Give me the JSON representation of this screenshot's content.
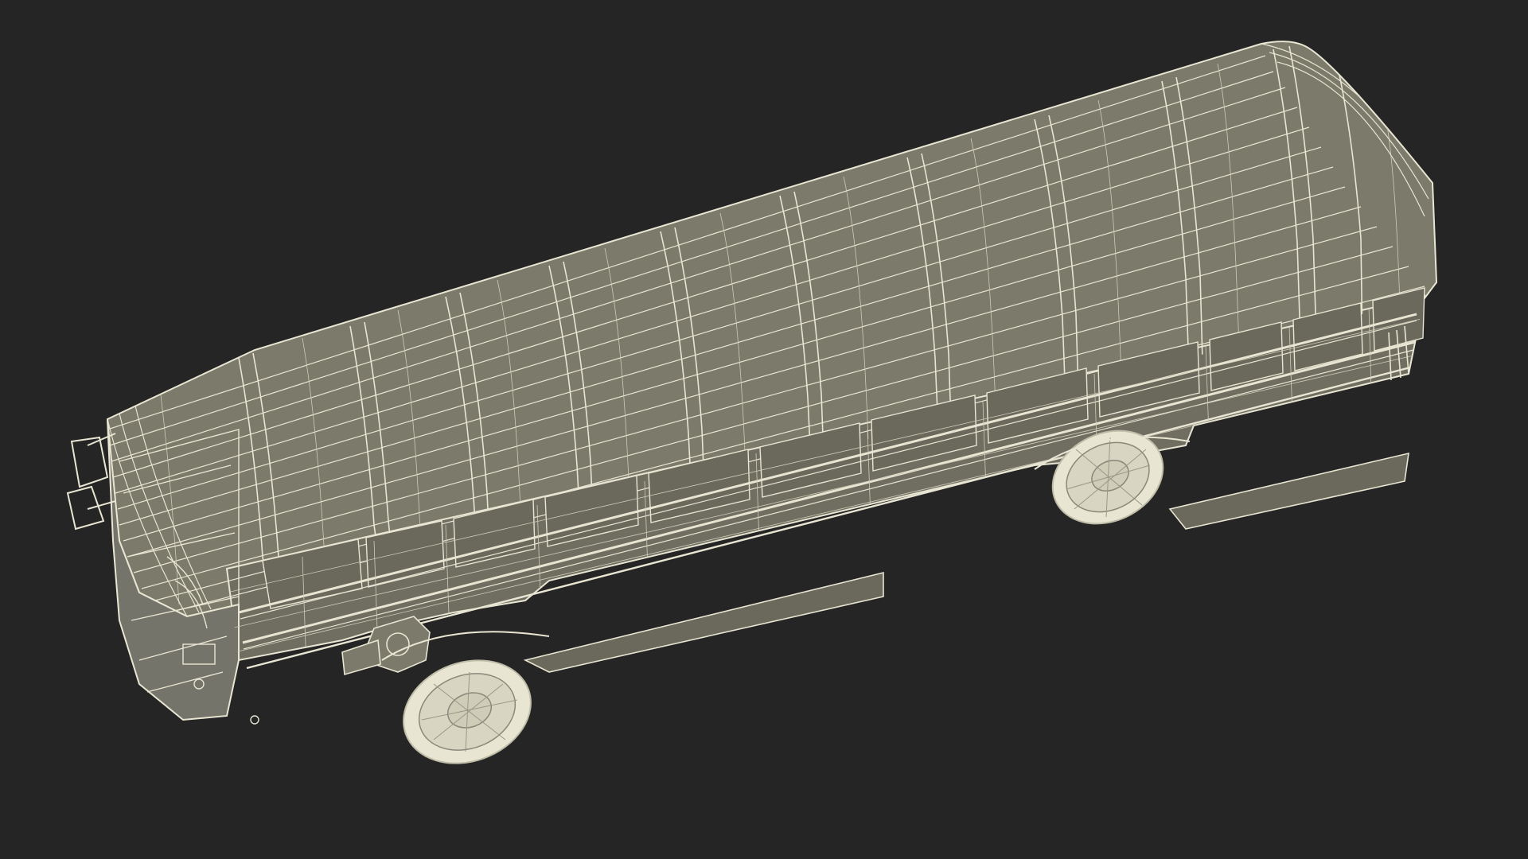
{
  "scene": {
    "background_color": "#252525",
    "model_fill_color": "#7b7a6b",
    "model_fill_dark_color": "#6c6b5e",
    "wire_color": "#e8e5d2",
    "wire_faint_color": "#cfccb8",
    "subject": "school-bus-wireframe"
  }
}
